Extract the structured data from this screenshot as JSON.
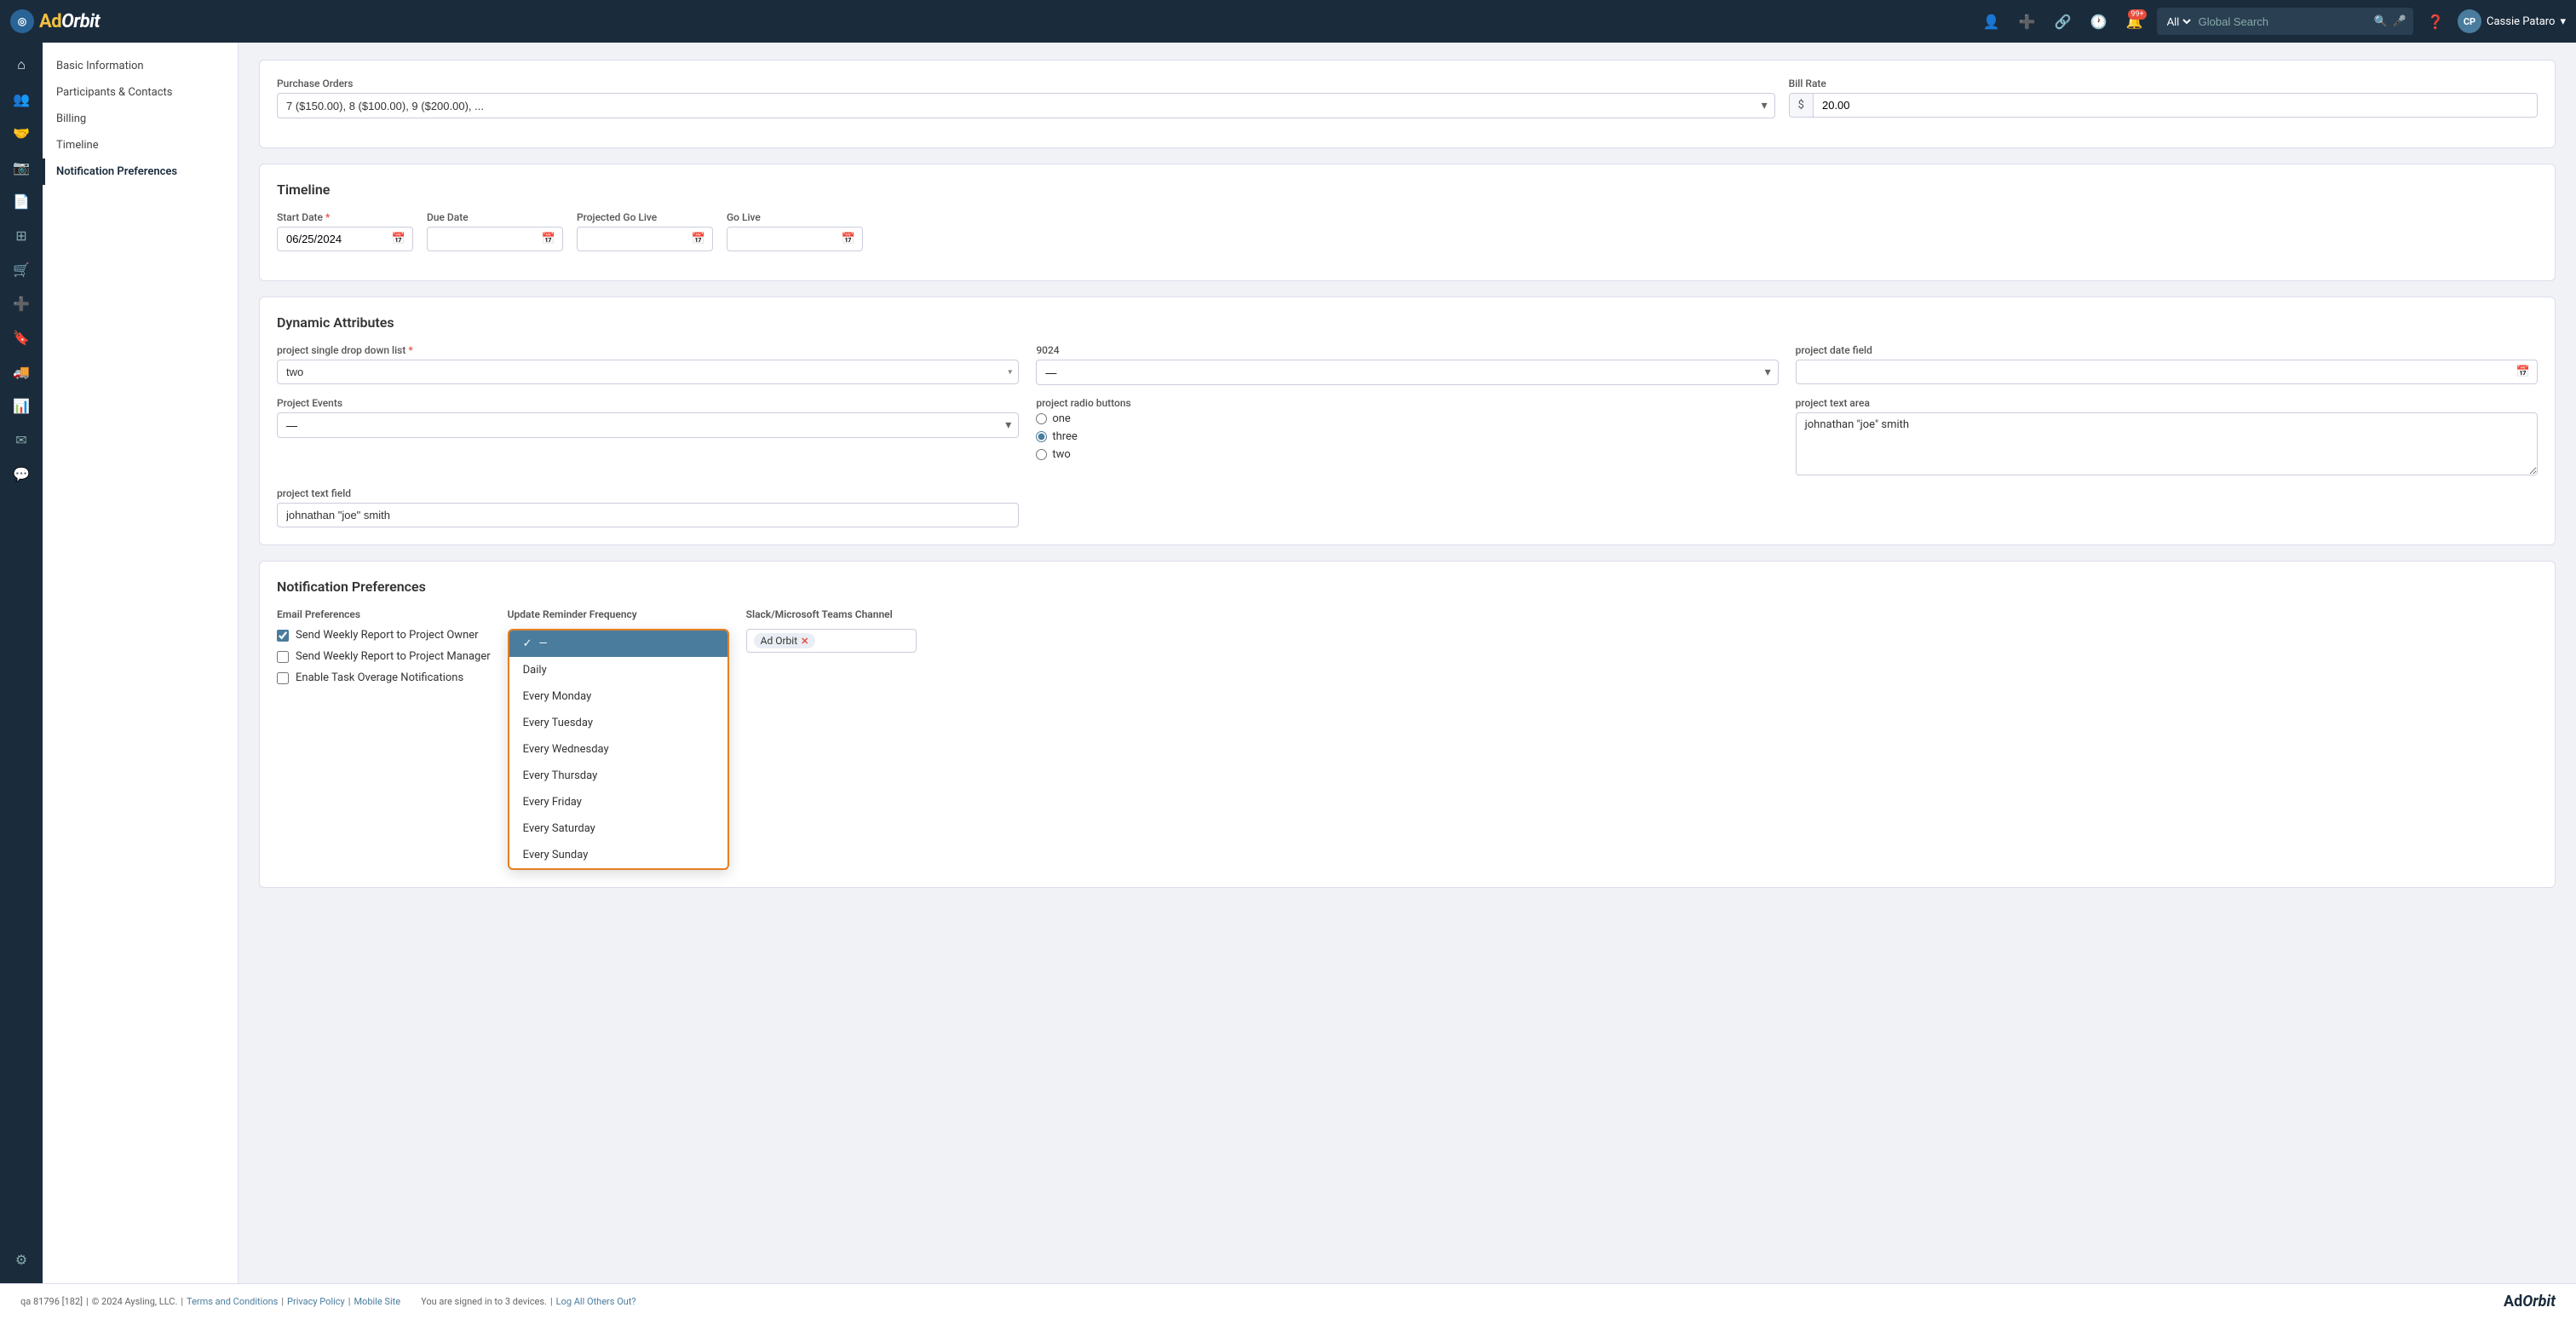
{
  "app": {
    "logo_text": "Ad",
    "logo_orbit": "Orbit",
    "brand_color": "#1a2b3c"
  },
  "nav": {
    "search_placeholder": "Global Search",
    "search_dropdown_value": "All",
    "user_name": "Cassie Pataro",
    "notification_count": "99+"
  },
  "icon_sidebar": {
    "items": [
      {
        "name": "home-icon",
        "symbol": "⌂"
      },
      {
        "name": "users-icon",
        "symbol": "👥"
      },
      {
        "name": "handshake-icon",
        "symbol": "🤝"
      },
      {
        "name": "photo-icon",
        "symbol": "📷"
      },
      {
        "name": "document-icon",
        "symbol": "📄"
      },
      {
        "name": "grid-icon",
        "symbol": "⊞"
      },
      {
        "name": "cart-icon",
        "symbol": "🛒"
      },
      {
        "name": "plus-box-icon",
        "symbol": "➕"
      },
      {
        "name": "bookmark-icon",
        "symbol": "🔖"
      },
      {
        "name": "truck-icon",
        "symbol": "🚚"
      },
      {
        "name": "chart-icon",
        "symbol": "📊"
      },
      {
        "name": "mail-icon",
        "symbol": "✉"
      },
      {
        "name": "chat-icon",
        "symbol": "💬"
      },
      {
        "name": "settings-icon",
        "symbol": "⚙"
      }
    ]
  },
  "left_nav": {
    "items": [
      {
        "label": "Basic Information",
        "active": false
      },
      {
        "label": "Participants & Contacts",
        "active": false
      },
      {
        "label": "Billing",
        "active": false
      },
      {
        "label": "Timeline",
        "active": false
      },
      {
        "label": "Notification Preferences",
        "active": true
      }
    ]
  },
  "purchase_orders": {
    "label": "Purchase Orders",
    "value": "7 ($150.00), 8 ($100.00), 9 ($200.00), ...",
    "bill_rate_label": "Bill Rate",
    "bill_rate_prefix": "$",
    "bill_rate_value": "20.00"
  },
  "timeline": {
    "section_title": "Timeline",
    "start_date_label": "Start Date",
    "start_date_value": "06/25/2024",
    "due_date_label": "Due Date",
    "projected_go_live_label": "Projected Go Live",
    "go_live_label": "Go Live"
  },
  "dynamic_attributes": {
    "section_title": "Dynamic Attributes",
    "project_single_label": "project single drop down list",
    "project_single_value": "two",
    "field_9024_label": "9024",
    "field_9024_value": "—",
    "project_date_label": "project date field",
    "project_events_label": "Project Events",
    "project_events_value": "—",
    "radio_label": "project radio buttons",
    "radio_options": [
      {
        "label": "one",
        "value": "one"
      },
      {
        "label": "three",
        "value": "three",
        "checked": true
      },
      {
        "label": "two",
        "value": "two"
      }
    ],
    "textarea_label": "project text area",
    "textarea_value": "johnathan \"joe\" smith",
    "text_field_label": "project text field",
    "text_field_value": "johnathan \"joe\" smith"
  },
  "notification_preferences": {
    "section_title": "Notification Preferences",
    "email_prefs_label": "Email Preferences",
    "checkboxes": [
      {
        "label": "Send Weekly Report to Project Owner",
        "checked": true
      },
      {
        "label": "Send Weekly Report to Project Manager",
        "checked": false
      },
      {
        "label": "Enable Task Overage Notifications",
        "checked": false
      }
    ],
    "update_reminder_label": "Update Reminder Frequency",
    "dropdown_selected": "—",
    "dropdown_options": [
      {
        "label": "—",
        "selected": true
      },
      {
        "label": "Daily"
      },
      {
        "label": "Every Monday"
      },
      {
        "label": "Every Tuesday"
      },
      {
        "label": "Every Wednesday"
      },
      {
        "label": "Every Thursday"
      },
      {
        "label": "Every Friday"
      },
      {
        "label": "Every Saturday"
      },
      {
        "label": "Every Sunday"
      }
    ],
    "slack_label": "Slack/Microsoft Teams Channel",
    "slack_chip": "Ad Orbit"
  },
  "footer": {
    "qa_text": "qa 81796 [182]",
    "copyright": "© 2024 Aysling, LLC.",
    "terms_label": "Terms and Conditions",
    "privacy_label": "Privacy Policy",
    "mobile_label": "Mobile Site",
    "signed_in": "You are signed in to 3 devices.",
    "log_out_label": "Log All Others Out?"
  }
}
